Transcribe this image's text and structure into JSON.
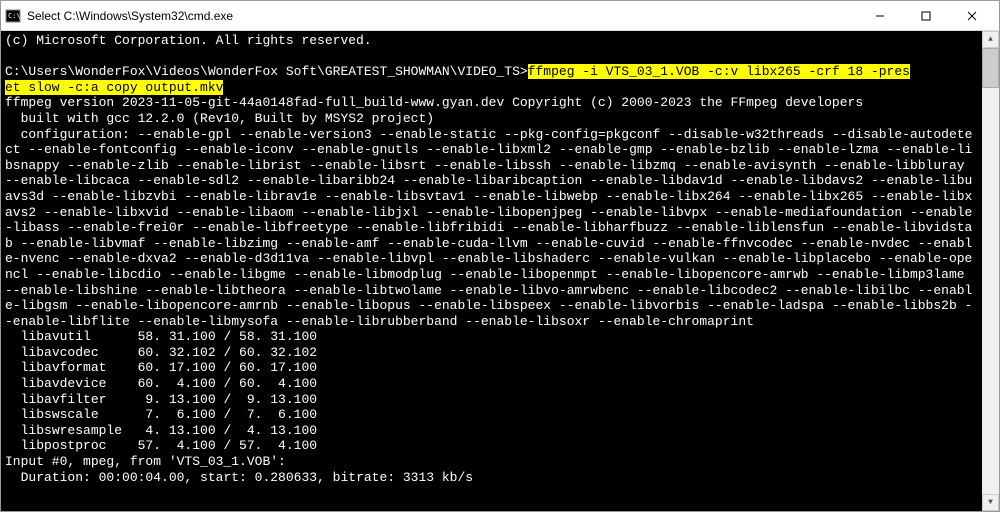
{
  "window": {
    "title": "Select C:\\Windows\\System32\\cmd.exe"
  },
  "terminal": {
    "copyright": "(c) Microsoft Corporation. All rights reserved.",
    "blank1": "",
    "prompt": "C:\\Users\\WonderFox\\Videos\\WonderFox Soft\\GREATEST_SHOWMAN\\VIDEO_TS>",
    "cmd_part1": "ffmpeg -i VTS_03_1.VOB -c:v libx265 -crf 18 -pres",
    "cmd_part2": "et slow -c:a copy output.mkv",
    "version": "ffmpeg version 2023-11-05-git-44a0148fad-full_build-www.gyan.dev Copyright (c) 2000-2023 the FFmpeg developers",
    "built": "  built with gcc 12.2.0 (Rev10, Built by MSYS2 project)",
    "config": "  configuration: --enable-gpl --enable-version3 --enable-static --pkg-config=pkgconf --disable-w32threads --disable-autodetect --enable-fontconfig --enable-iconv --enable-gnutls --enable-libxml2 --enable-gmp --enable-bzlib --enable-lzma --enable-libsnappy --enable-zlib --enable-librist --enable-libsrt --enable-libssh --enable-libzmq --enable-avisynth --enable-libbluray --enable-libcaca --enable-sdl2 --enable-libaribb24 --enable-libaribcaption --enable-libdav1d --enable-libdavs2 --enable-libuavs3d --enable-libzvbi --enable-librav1e --enable-libsvtav1 --enable-libwebp --enable-libx264 --enable-libx265 --enable-libxavs2 --enable-libxvid --enable-libaom --enable-libjxl --enable-libopenjpeg --enable-libvpx --enable-mediafoundation --enable-libass --enable-frei0r --enable-libfreetype --enable-libfribidi --enable-libharfbuzz --enable-liblensfun --enable-libvidstab --enable-libvmaf --enable-libzimg --enable-amf --enable-cuda-llvm --enable-cuvid --enable-ffnvcodec --enable-nvdec --enable-nvenc --enable-dxva2 --enable-d3d11va --enable-libvpl --enable-libshaderc --enable-vulkan --enable-libplacebo --enable-opencl --enable-libcdio --enable-libgme --enable-libmodplug --enable-libopenmpt --enable-libopencore-amrwb --enable-libmp3lame --enable-libshine --enable-libtheora --enable-libtwolame --enable-libvo-amrwbenc --enable-libcodec2 --enable-libilbc --enable-libgsm --enable-libopencore-amrnb --enable-libopus --enable-libspeex --enable-libvorbis --enable-ladspa --enable-libbs2b --enable-libflite --enable-libmysofa --enable-librubberband --enable-libsoxr --enable-chromaprint",
    "lib1": "  libavutil      58. 31.100 / 58. 31.100",
    "lib2": "  libavcodec     60. 32.102 / 60. 32.102",
    "lib3": "  libavformat    60. 17.100 / 60. 17.100",
    "lib4": "  libavdevice    60.  4.100 / 60.  4.100",
    "lib5": "  libavfilter     9. 13.100 /  9. 13.100",
    "lib6": "  libswscale      7.  6.100 /  7.  6.100",
    "lib7": "  libswresample   4. 13.100 /  4. 13.100",
    "lib8": "  libpostproc    57.  4.100 / 57.  4.100",
    "input": "Input #0, mpeg, from 'VTS_03_1.VOB':",
    "duration": "  Duration: 00:00:04.00, start: 0.280633, bitrate: 3313 kb/s"
  }
}
